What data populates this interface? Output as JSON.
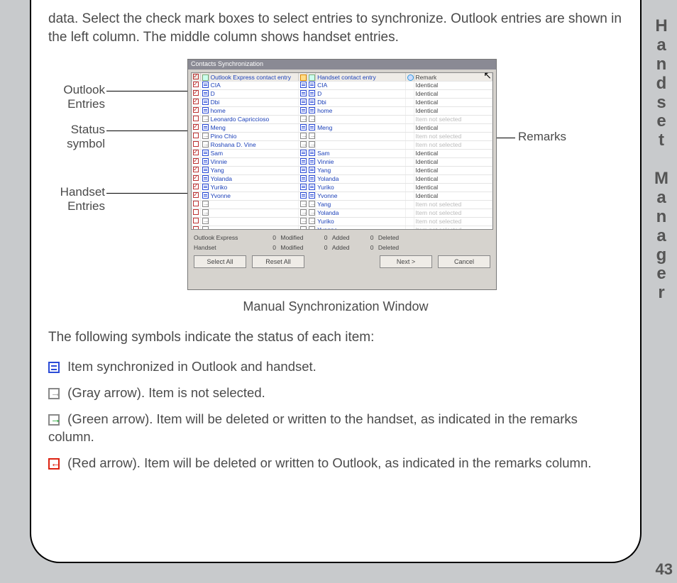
{
  "side_title": "Handset Manager",
  "page_number": "43",
  "intro": "data.  Select the check mark boxes to select entries to synchronize. Outlook entries are shown in the left column. The middle column shows handset entries.",
  "caption": "Manual Synchronization Window",
  "labels": {
    "outlook_entries_1": "Outlook",
    "outlook_entries_2": "Entries",
    "status_1": "Status",
    "status_2": "symbol",
    "handset_1": "Handset",
    "handset_2": "Entries",
    "remarks": "Remarks"
  },
  "symbols_intro": "The following symbols indicate the status of each item:",
  "legend": {
    "sync": " Item synchronized in Outlook and handset.",
    "gray": "(Gray arrow). Item is not selected.",
    "green": " (Green arrow). Item will be deleted or written to the handset, as indicated in the remarks column.",
    "red": " (Red arrow). Item will be deleted or written to Outlook, as indicated in the remarks column."
  },
  "dialog": {
    "title": "Contacts Synchronization",
    "headers": {
      "outlook": "Outlook Express contact entry",
      "handset": "Handset contact entry",
      "remark": "Remark"
    },
    "rows": [
      {
        "chk": true,
        "st": "blue",
        "o": "CIA",
        "st2": "blue",
        "h": "CIA",
        "r": "Identical",
        "g": false
      },
      {
        "chk": true,
        "st": "blue",
        "o": "D",
        "st2": "blue",
        "h": "D",
        "r": "Identical",
        "g": false
      },
      {
        "chk": true,
        "st": "blue",
        "o": "Dbi",
        "st2": "blue",
        "h": "Dbi",
        "r": "Identical",
        "g": false
      },
      {
        "chk": true,
        "st": "blue",
        "o": "home",
        "st2": "blue",
        "h": "home",
        "r": "Identical",
        "g": false
      },
      {
        "chk": false,
        "st": "gray",
        "o": "Leonardo Capriccioso",
        "st2": "gray",
        "h": "",
        "r": "Item not selected",
        "g": true
      },
      {
        "chk": true,
        "st": "blue",
        "o": "Meng",
        "st2": "blue",
        "h": "Meng",
        "r": "Identical",
        "g": false
      },
      {
        "chk": false,
        "st": "gray",
        "o": "Pino Chio",
        "st2": "gray",
        "h": "",
        "r": "Item not selected",
        "g": true
      },
      {
        "chk": false,
        "st": "gray",
        "o": "Roshana D. Vine",
        "st2": "gray",
        "h": "",
        "r": "Item not selected",
        "g": true
      },
      {
        "chk": true,
        "st": "blue",
        "o": "Sam",
        "st2": "blue",
        "h": "Sam",
        "r": "Identical",
        "g": false
      },
      {
        "chk": true,
        "st": "blue",
        "o": "Vinnie",
        "st2": "blue",
        "h": "Vinnie",
        "r": "Identical",
        "g": false
      },
      {
        "chk": true,
        "st": "blue",
        "o": "Yang",
        "st2": "blue",
        "h": "Yang",
        "r": "Identical",
        "g": false
      },
      {
        "chk": true,
        "st": "blue",
        "o": "Yolanda",
        "st2": "blue",
        "h": "Yolanda",
        "r": "Identical",
        "g": false
      },
      {
        "chk": true,
        "st": "blue",
        "o": "Yuriko",
        "st2": "blue",
        "h": "Yuriko",
        "r": "Identical",
        "g": false
      },
      {
        "chk": true,
        "st": "blue",
        "o": "Yvonne",
        "st2": "blue",
        "h": "Yvonne",
        "r": "Identical",
        "g": false
      },
      {
        "chk": false,
        "st": "gray",
        "o": "",
        "st2": "gray",
        "h": "Yang",
        "r": "Item not selected",
        "g": true
      },
      {
        "chk": false,
        "st": "gray",
        "o": "",
        "st2": "gray",
        "h": "Yolanda",
        "r": "Item not selected",
        "g": true
      },
      {
        "chk": false,
        "st": "gray",
        "o": "",
        "st2": "gray",
        "h": "Yuriko",
        "r": "Item not selected",
        "g": true
      },
      {
        "chk": false,
        "st": "gray",
        "o": "",
        "st2": "gray",
        "h": "Yvonne",
        "r": "Item not selected",
        "g": true
      }
    ],
    "stats": {
      "row1_label": "Outlook Express",
      "row2_label": "Handset",
      "mod_n": "0",
      "mod": "Modified",
      "add_n": "0",
      "add": "Added",
      "del_n": "0",
      "del": "Deleted"
    },
    "buttons": {
      "select_all": "Select All",
      "reset_all": "Reset All",
      "next": "Next >",
      "cancel": "Cancel"
    }
  }
}
